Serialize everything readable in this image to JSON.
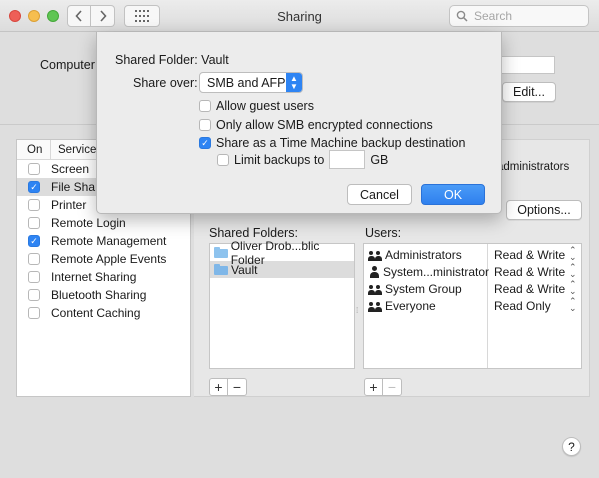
{
  "window": {
    "title": "Sharing",
    "search_placeholder": "Search"
  },
  "background": {
    "computer_name_label": "Computer",
    "edit_label": "Edit...",
    "admins_text": "administrators",
    "options_label": "Options..."
  },
  "services": {
    "header_on": "On",
    "header_service": "Service",
    "items": [
      {
        "label": "Screen",
        "checked": false
      },
      {
        "label": "File Sha",
        "checked": true,
        "selected": true
      },
      {
        "label": "Printer",
        "checked": false
      },
      {
        "label": "Remote Login",
        "checked": false
      },
      {
        "label": "Remote Management",
        "checked": true
      },
      {
        "label": "Remote Apple Events",
        "checked": false
      },
      {
        "label": "Internet Sharing",
        "checked": false
      },
      {
        "label": "Bluetooth Sharing",
        "checked": false
      },
      {
        "label": "Content Caching",
        "checked": false
      }
    ]
  },
  "shared_folders": {
    "label": "Shared Folders:",
    "items": [
      {
        "name": "Oliver Drob...blic Folder"
      },
      {
        "name": "Vault",
        "selected": true
      }
    ]
  },
  "users": {
    "label": "Users:",
    "items": [
      {
        "name": "Administrators",
        "permission": "Read & Write",
        "kind": "group"
      },
      {
        "name": "System...ministrator",
        "permission": "Read & Write",
        "kind": "user"
      },
      {
        "name": "System Group",
        "permission": "Read & Write",
        "kind": "group"
      },
      {
        "name": "Everyone",
        "permission": "Read Only",
        "kind": "group"
      }
    ]
  },
  "list_buttons": {
    "add": "+",
    "remove": "−"
  },
  "help_label": "?",
  "sheet": {
    "shared_folder_title": "Shared Folder: Vault",
    "share_over_label": "Share over:",
    "share_over_value": "SMB and AFP",
    "allow_guest": {
      "label": "Allow guest users",
      "checked": false
    },
    "smb_encrypted": {
      "label": "Only allow SMB encrypted connections",
      "checked": false
    },
    "time_machine": {
      "label": "Share as a Time Machine backup destination",
      "checked": true
    },
    "limit_backups": {
      "label": "Limit backups to",
      "checked": false,
      "unit": "GB",
      "value": ""
    },
    "cancel_label": "Cancel",
    "ok_label": "OK"
  },
  "colors": {
    "accent": "#2e84f3",
    "selection": "#dcdcdc"
  }
}
